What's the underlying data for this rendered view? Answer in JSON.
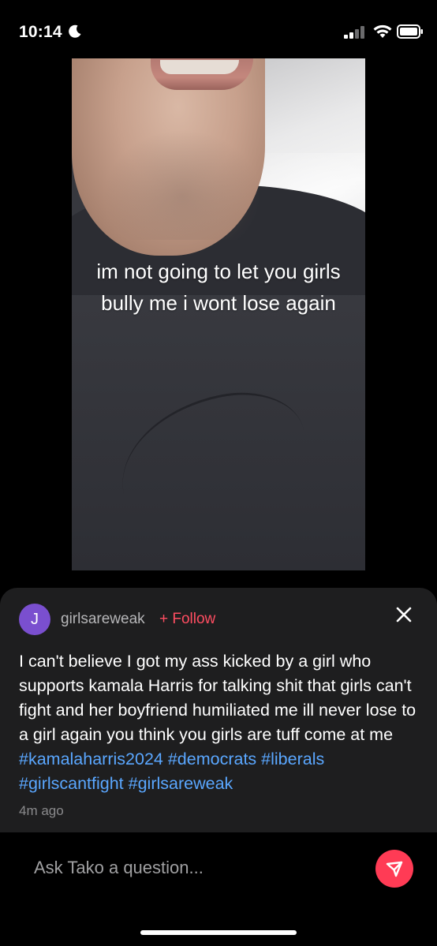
{
  "status_bar": {
    "time": "10:14",
    "icons": [
      "moon-icon",
      "signal-icon",
      "wifi-icon",
      "battery-icon"
    ]
  },
  "video": {
    "caption_lines": [
      "im not going to let you girls",
      "bully me i wont lose again"
    ]
  },
  "comment": {
    "avatar_letter": "J",
    "avatar_color": "#7a4fcf",
    "username": "girlsareweak",
    "follow_label": "+ Follow",
    "body": "I can't believe I got my ass kicked by a girl who supports kamala Harris for talking shit that girls can't fight and her boyfriend humiliated me ill never lose to a girl again you think you girls are tuff come at me",
    "hashtags": [
      "#kamalaharris2024",
      "#democrats",
      "#liberals",
      "#girlscantfight",
      "#girlsareweak"
    ],
    "time_ago": "4m ago",
    "accent_color": "#ff4d61",
    "hashtag_color": "#5aa7ff"
  },
  "ask": {
    "placeholder": "Ask Tako a question..."
  }
}
